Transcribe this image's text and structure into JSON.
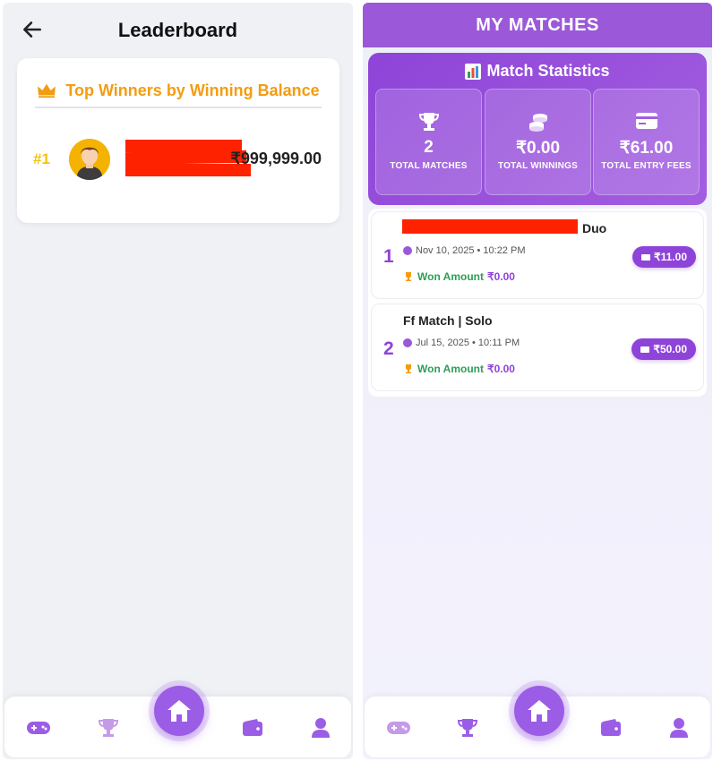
{
  "leaderboard": {
    "title": "Leaderboard",
    "card_title": "Top Winners by Winning Balance",
    "entries": [
      {
        "rank": "#1",
        "amount": "₹999,999.00"
      }
    ]
  },
  "my_matches": {
    "title": "MY MATCHES",
    "stats_title": "Match Statistics",
    "stats": [
      {
        "value": "2",
        "label": "TOTAL MATCHES",
        "icon": "trophy-icon"
      },
      {
        "value": "₹0.00",
        "label": "TOTAL WINNINGS",
        "icon": "coins-icon"
      },
      {
        "value": "₹61.00",
        "label": "TOTAL ENTRY FEES",
        "icon": "credit-card-icon"
      }
    ],
    "matches": [
      {
        "index": "1",
        "title_suffix": "Duo",
        "date": "Nov 10, 2025 • 10:22 PM",
        "won_label": "Won Amount",
        "won_value": "₹0.00",
        "fee": "₹11.00"
      },
      {
        "index": "2",
        "title": "Ff Match | Solo",
        "date": "Jul 15, 2025 • 10:11 PM",
        "won_label": "Won Amount",
        "won_value": "₹0.00",
        "fee": "₹50.00"
      }
    ]
  },
  "nav": [
    "gamepad-icon",
    "trophy-icon",
    "home-icon",
    "wallet-icon",
    "user-icon"
  ],
  "colors": {
    "accent": "#9b5de5",
    "gold": "#f39c12",
    "won": "#2e9e55"
  }
}
